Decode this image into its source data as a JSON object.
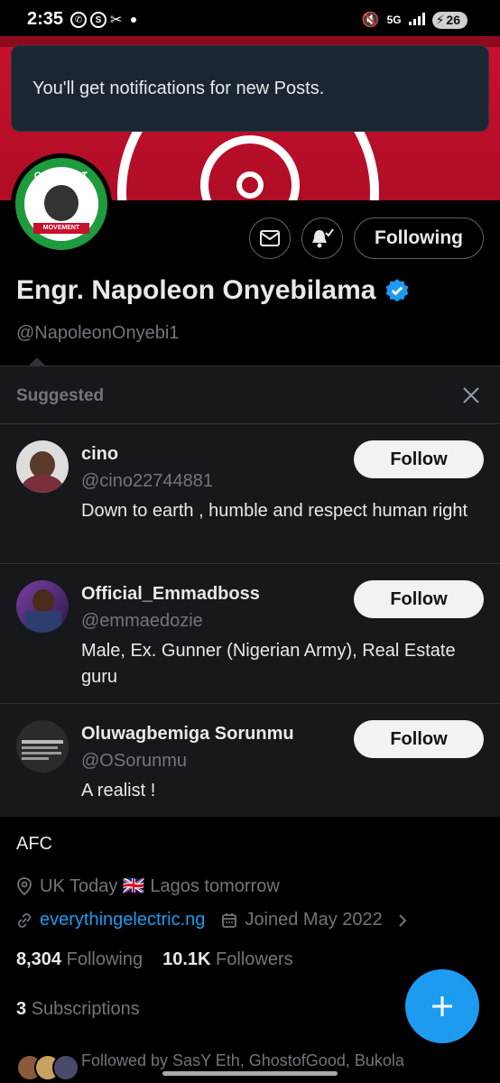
{
  "status_bar": {
    "time": "2:35",
    "network": "5G",
    "battery": "26"
  },
  "toast": {
    "message": "You'll get notifications for new Posts."
  },
  "avatar": {
    "top_text": "OBIDIENT",
    "ribbon_text": "MOVEMENT"
  },
  "profile": {
    "name": "Engr. Napoleon Onyebilama",
    "handle": "@NapoleonOnyebi1",
    "following_label": "Following",
    "bio": "AFC",
    "location": "UK Today 🇬🇧 Lagos tomorrow",
    "website": "everythingelectric.ng",
    "joined": "Joined May 2022",
    "following_count": "8,304",
    "following_label_count": "Following",
    "followers_count": "10.1K",
    "followers_label": "Followers",
    "subscriptions_count": "3",
    "subscriptions_label": "Subscriptions",
    "followed_by": "Followed by SasY Eth, GhostofGood, Bukola"
  },
  "suggested": {
    "title": "Suggested",
    "items": [
      {
        "name": "cino",
        "handle": "@cino22744881",
        "bio": "Down to earth , humble and respect human right",
        "button": "Follow"
      },
      {
        "name": "Official_Emmadboss",
        "handle": "@emmaedozie",
        "bio": "Male, Ex. Gunner (Nigerian Army), Real Estate guru",
        "button": "Follow"
      },
      {
        "name": "Oluwagbemiga Sorunmu",
        "handle": "@OSorunmu",
        "bio": "A realist !",
        "button": "Follow"
      }
    ]
  },
  "colors": {
    "accent": "#1d9bf0",
    "banner": "#c8102e",
    "panel": "#16181c"
  }
}
